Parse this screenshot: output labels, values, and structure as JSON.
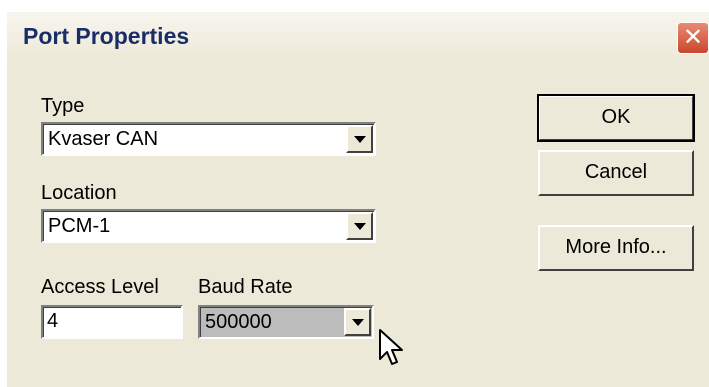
{
  "dialog": {
    "title": "Port Properties",
    "close_glyph": "✕"
  },
  "fields": {
    "type_label": "Type",
    "type_value": "Kvaser CAN",
    "location_label": "Location",
    "location_value": "PCM-1",
    "access_label": "Access Level",
    "access_value": "4",
    "baud_label": "Baud Rate",
    "baud_value": "500000"
  },
  "buttons": {
    "ok": "OK",
    "cancel": "Cancel",
    "more_info": "More Info..."
  },
  "icons": {
    "close": "close-icon",
    "dropdown": "chevron-down-icon",
    "cursor": "arrow-cursor-icon"
  },
  "colors": {
    "title_text": "#1a2d66",
    "close_button": "#d35f45",
    "dialog_bg": "#ece9d8"
  }
}
